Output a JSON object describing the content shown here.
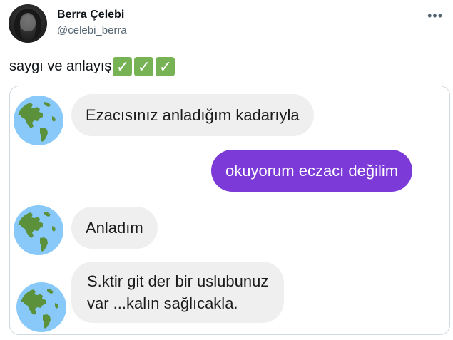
{
  "tweet": {
    "author_name": "Berra Çelebi",
    "author_handle": "@celebi_berra",
    "more_label": "•••",
    "text": "saygı ve anlayış",
    "check_emoji": [
      "✓",
      "✓",
      "✓"
    ]
  },
  "chat": {
    "messages": [
      {
        "sender": "them",
        "text": "Ezacısınız anladığım kadarıyla"
      },
      {
        "sender": "me",
        "text": "okuyorum eczacı değilim"
      },
      {
        "sender": "them",
        "text": "Anladım"
      },
      {
        "sender": "them",
        "line1": "S.ktir git der bir uslubunuz",
        "line2": "var ...kalın sağlıcakla."
      }
    ]
  },
  "colors": {
    "incoming_bubble": "#efefef",
    "outgoing_bubble": "#7c3ad8",
    "check_green": "#77b255",
    "globe_ocean": "#88c9f9",
    "globe_land": "#5c913b"
  }
}
